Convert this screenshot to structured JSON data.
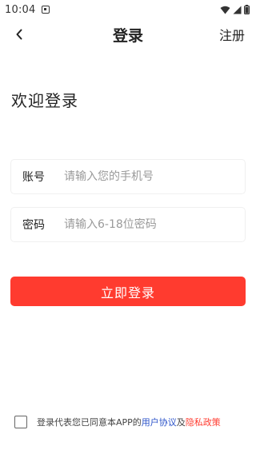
{
  "status_bar": {
    "time": "10:04"
  },
  "header": {
    "title": "登录",
    "register_label": "注册"
  },
  "welcome_text": "欢迎登录",
  "account_field": {
    "label": "账号",
    "placeholder": "请输入您的手机号",
    "value": ""
  },
  "password_field": {
    "label": "密码",
    "placeholder": "请输入6-18位密码",
    "value": ""
  },
  "login_button_label": "立即登录",
  "agreement": {
    "checked": false,
    "prefix": "登录代表您已同意本APP的",
    "user_agreement": "用户协议",
    "conjunction": "及",
    "privacy_policy": "隐私政策"
  },
  "colors": {
    "accent": "#ff3b2f",
    "link_blue": "#2a52c9"
  },
  "icons": [
    "notification-icon",
    "wifi-icon",
    "signal-icon",
    "battery-icon",
    "back-chevron-icon"
  ]
}
